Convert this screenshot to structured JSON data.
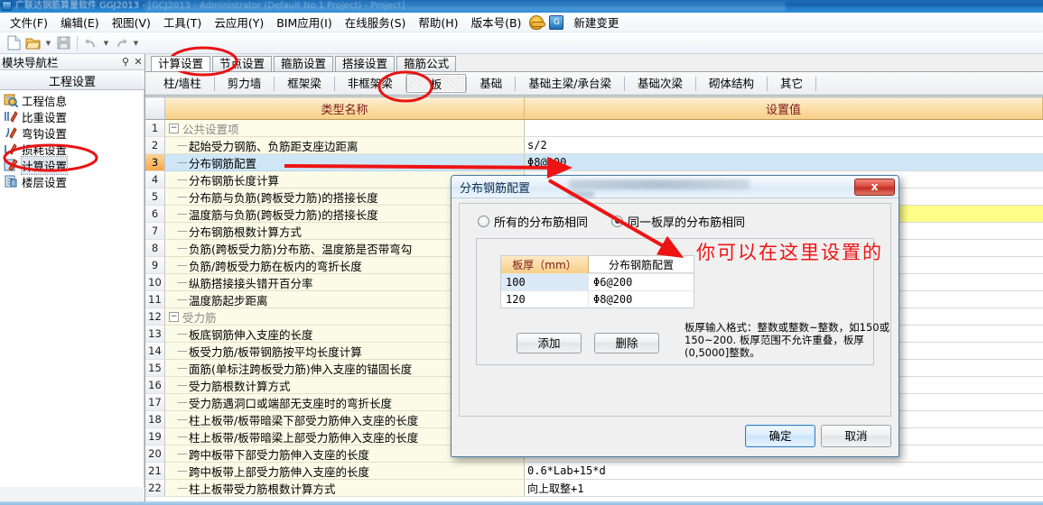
{
  "window": {
    "title_fragment": "广联达钢筋算量软件 GGJ2013 - [GCJ2013 - Administrator (Default No.1 Project) - Project]"
  },
  "menubar": {
    "items": [
      {
        "label": "文件(F)",
        "name": "menu-file"
      },
      {
        "label": "编辑(E)",
        "name": "menu-edit"
      },
      {
        "label": "视图(V)",
        "name": "menu-view"
      },
      {
        "label": "工具(T)",
        "name": "menu-tools"
      },
      {
        "label": "云应用(Y)",
        "name": "menu-cloud"
      },
      {
        "label": "BIM应用(I)",
        "name": "menu-bim"
      },
      {
        "label": "在线服务(S)",
        "name": "menu-online-service"
      },
      {
        "label": "帮助(H)",
        "name": "menu-help"
      },
      {
        "label": "版本号(B)",
        "name": "menu-version"
      }
    ],
    "helmet_icon": "helmet-icon",
    "blue_icon": "glodon-icon",
    "new_change_label": "新建变更"
  },
  "toolbar": {
    "buttons": [
      {
        "name": "new-file-icon",
        "glyph": "new"
      },
      {
        "name": "open-file-icon",
        "glyph": "open"
      },
      {
        "name": "open-dropdown-icon",
        "glyph": "caret"
      },
      {
        "name": "save-icon",
        "glyph": "save"
      },
      {
        "name": "undo-icon",
        "glyph": "undo"
      },
      {
        "name": "undo-dropdown-icon",
        "glyph": "caret"
      },
      {
        "name": "redo-icon",
        "glyph": "redo"
      },
      {
        "name": "redo-dropdown-icon",
        "glyph": "caret"
      }
    ]
  },
  "dock": {
    "title": "模块导航栏",
    "pin_icon": "pin-icon",
    "close_icon": "close-icon",
    "group_label": "工程设置",
    "items": [
      {
        "label": "工程信息",
        "icon": "project-info-icon"
      },
      {
        "label": "比重设置",
        "icon": "weight-settings-icon"
      },
      {
        "label": "弯钩设置",
        "icon": "hook-settings-icon"
      },
      {
        "label": "损耗设置",
        "icon": "loss-settings-icon"
      },
      {
        "label": "计算设置",
        "icon": "calc-settings-icon",
        "selected": true
      },
      {
        "label": "楼层设置",
        "icon": "floor-settings-icon"
      }
    ]
  },
  "tabs_primary": [
    {
      "label": "计算设置",
      "active": true
    },
    {
      "label": "节点设置",
      "active": false
    },
    {
      "label": "箍筋设置",
      "active": false
    },
    {
      "label": "搭接设置",
      "active": false
    },
    {
      "label": "箍筋公式",
      "active": false
    }
  ],
  "tabs_secondary": [
    {
      "label": "柱/墙柱",
      "active": false
    },
    {
      "label": "剪力墙",
      "active": false
    },
    {
      "label": "框架梁",
      "active": false
    },
    {
      "label": "非框架梁",
      "active": false
    },
    {
      "label": "板",
      "active": true
    },
    {
      "label": "基础",
      "active": false
    },
    {
      "label": "基础主梁/承台梁",
      "active": false
    },
    {
      "label": "基础次梁",
      "active": false
    },
    {
      "label": "砌体结构",
      "active": false
    },
    {
      "label": "其它",
      "active": false
    }
  ],
  "grid": {
    "columns": [
      "类型名称",
      "设置值"
    ],
    "rows": [
      {
        "num": "1",
        "name": "公共设置项",
        "value": "",
        "kind": "group"
      },
      {
        "num": "2",
        "name": "起始受力钢筋、负筋距支座边距离",
        "value": "s/2",
        "kind": "item"
      },
      {
        "num": "3",
        "name": "分布钢筋配置",
        "value": "Φ8@200",
        "kind": "item",
        "selected": true
      },
      {
        "num": "4",
        "name": "分布钢筋长度计算",
        "value": "",
        "kind": "item"
      },
      {
        "num": "5",
        "name": "分布筋与负筋(跨板受力筋)的搭接长度",
        "value": "",
        "kind": "item"
      },
      {
        "num": "6",
        "name": "温度筋与负筋(跨板受力筋)的搭接长度",
        "value": "",
        "kind": "item",
        "highlight": true
      },
      {
        "num": "7",
        "name": "分布钢筋根数计算方式",
        "value": "",
        "kind": "item"
      },
      {
        "num": "8",
        "name": "负筋(跨板受力筋)分布筋、温度筋是否带弯勾",
        "value": "",
        "kind": "item"
      },
      {
        "num": "9",
        "name": "负筋/跨板受力筋在板内的弯折长度",
        "value": "",
        "kind": "item"
      },
      {
        "num": "10",
        "name": "纵筋搭接接头错开百分率",
        "value": "",
        "kind": "item"
      },
      {
        "num": "11",
        "name": "温度筋起步距离",
        "value": "",
        "kind": "item"
      },
      {
        "num": "12",
        "name": "受力筋",
        "value": "",
        "kind": "group"
      },
      {
        "num": "13",
        "name": "板底钢筋伸入支座的长度",
        "value": "",
        "kind": "item"
      },
      {
        "num": "14",
        "name": "板受力筋/板带钢筋按平均长度计算",
        "value": "",
        "kind": "item"
      },
      {
        "num": "15",
        "name": "面筋(单标注跨板受力筋)伸入支座的锚固长度",
        "value": "",
        "kind": "item"
      },
      {
        "num": "16",
        "name": "受力筋根数计算方式",
        "value": "",
        "kind": "item"
      },
      {
        "num": "17",
        "name": "受力筋遇洞口或端部无支座时的弯折长度",
        "value": "",
        "kind": "item"
      },
      {
        "num": "18",
        "name": "柱上板带/板带暗梁下部受力筋伸入支座的长度",
        "value": "",
        "kind": "item"
      },
      {
        "num": "19",
        "name": "柱上板带/板带暗梁上部受力筋伸入支座的长度",
        "value": "",
        "kind": "item"
      },
      {
        "num": "20",
        "name": "跨中板带下部受力筋伸入支座的长度",
        "value": "",
        "kind": "item"
      },
      {
        "num": "21",
        "name": "跨中板带上部受力筋伸入支座的长度",
        "value": "0.6*Lab+15*d",
        "kind": "item"
      },
      {
        "num": "22",
        "name": "柱上板带受力筋根数计算方式",
        "value": "向上取整+1",
        "kind": "item"
      }
    ]
  },
  "dialog": {
    "title": "分布钢筋配置",
    "close_label": "x",
    "radios": [
      {
        "label": "所有的分布筋相同",
        "selected": false
      },
      {
        "label": "同一板厚的分布筋相同",
        "selected": true
      }
    ],
    "table": {
      "columns": [
        "板厚（mm）",
        "分布钢筋配置"
      ],
      "rows": [
        {
          "thickness": "100",
          "rebar": "Φ6@200",
          "selected": true
        },
        {
          "thickness": "120",
          "rebar": "Φ8@200",
          "selected": false
        }
      ]
    },
    "add_label": "添加",
    "delete_label": "删除",
    "hint": "板厚输入格式：整数或整数~整数，如150或150~200. 板厚范围不允许重叠，板厚(0,5000]整数。",
    "ok_label": "确定",
    "cancel_label": "取消"
  },
  "annotations": {
    "note_text": "你可以在这里设置的",
    "color": "#ee1414",
    "ellipses": [
      "计算设置-sidebar",
      "计算设置-tab",
      "板-tab"
    ],
    "arrows": [
      "row3-to-dialog",
      "dialog-title-to-table"
    ]
  }
}
